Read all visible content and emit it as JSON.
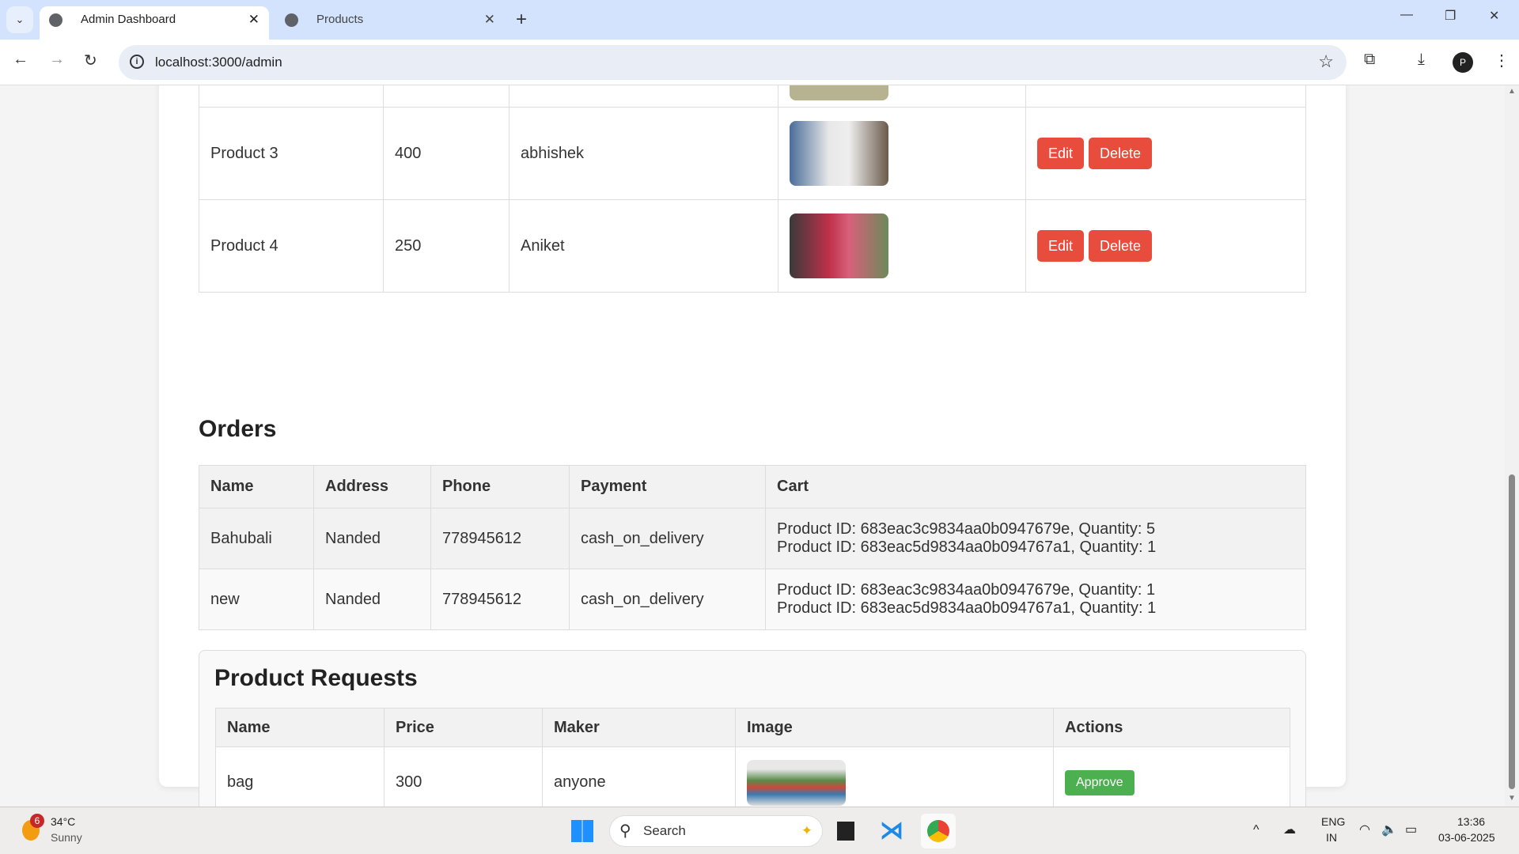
{
  "browser": {
    "tabs": [
      {
        "title": "Admin Dashboard",
        "active": true
      },
      {
        "title": "Products",
        "active": false
      }
    ],
    "url": "localhost:3000/admin",
    "profile_initial": "P"
  },
  "products": {
    "rows": [
      {
        "name": "Product 3",
        "price": "400",
        "maker": "abhishek",
        "image_color": "#7f9bb8"
      },
      {
        "name": "Product 4",
        "price": "250",
        "maker": "Aniket",
        "image_color": "#b4424a"
      }
    ],
    "edit_label": "Edit",
    "delete_label": "Delete"
  },
  "orders": {
    "title": "Orders",
    "headers": [
      "Name",
      "Address",
      "Phone",
      "Payment",
      "Cart"
    ],
    "rows": [
      {
        "name": "Bahubali",
        "address": "Nanded",
        "phone": "778945612",
        "payment": "cash_on_delivery",
        "cart": [
          "Product ID: 683eac3c9834aa0b0947679e, Quantity: 5",
          "Product ID: 683eac5d9834aa0b094767a1, Quantity: 1"
        ]
      },
      {
        "name": "new",
        "address": "Nanded",
        "phone": "778945612",
        "payment": "cash_on_delivery",
        "cart": [
          "Product ID: 683eac3c9834aa0b0947679e, Quantity: 1",
          "Product ID: 683eac5d9834aa0b094767a1, Quantity: 1"
        ]
      }
    ]
  },
  "requests": {
    "title": "Product Requests",
    "headers": [
      "Name",
      "Price",
      "Maker",
      "Image",
      "Actions"
    ],
    "rows": [
      {
        "name": "bag",
        "price": "300",
        "maker": "anyone",
        "approve_label": "Approve"
      }
    ]
  },
  "taskbar": {
    "weather_temp": "34°C",
    "weather_text": "Sunny",
    "weather_badge": "6",
    "search_placeholder": "Search",
    "lang": "ENG",
    "region": "IN",
    "time": "13:36",
    "date": "03-06-2025"
  },
  "colors": {
    "danger": "#e74c3c",
    "success": "#4caf50"
  }
}
